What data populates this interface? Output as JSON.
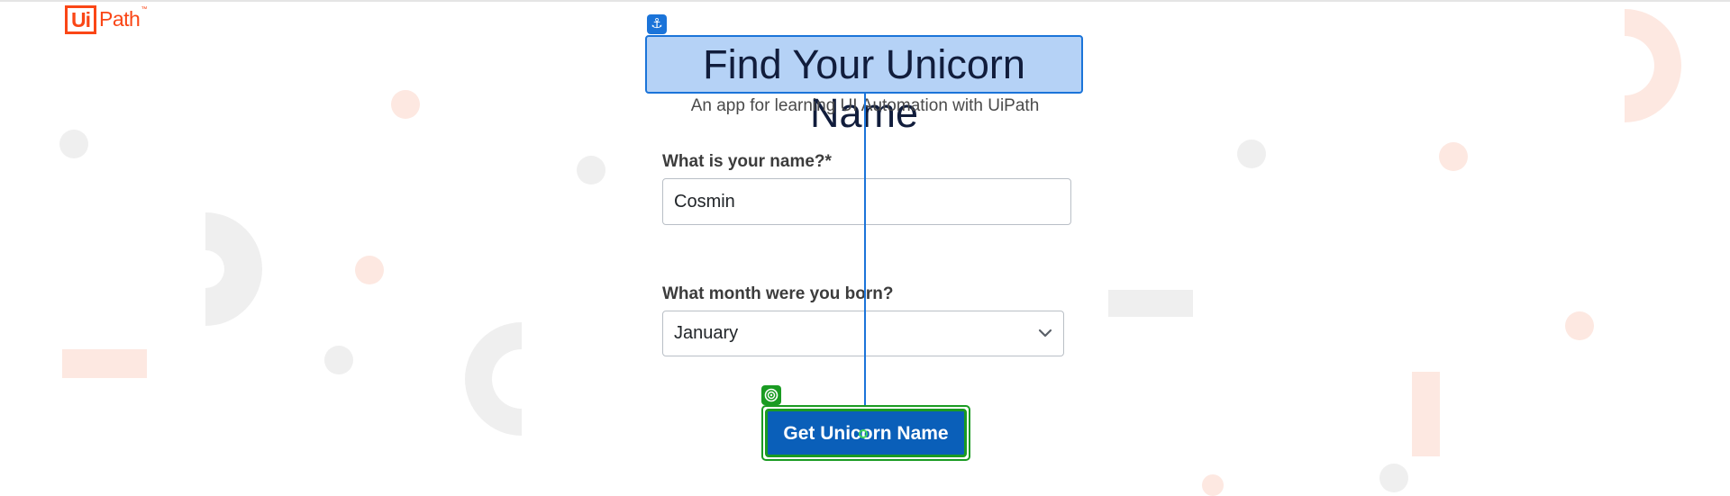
{
  "brand": {
    "ui": "Ui",
    "path": "Path",
    "tm": "™"
  },
  "header": {
    "title": "Find Your Unicorn Name",
    "subtitle": "An app for learning UI Automation with UiPath"
  },
  "form": {
    "name_label": "What is your name?*",
    "name_value": "Cosmin",
    "month_label": "What month were you born?",
    "month_value": "January",
    "submit_label": "Get Unicorn Name"
  },
  "overlay": {
    "anchor_icon": "anchor-icon",
    "target_icon": "target-icon",
    "anchor_color": "#1b74d9",
    "target_color": "#1a9b22"
  },
  "colors": {
    "brand": "#fa4616",
    "button": "#0a5fb9"
  }
}
